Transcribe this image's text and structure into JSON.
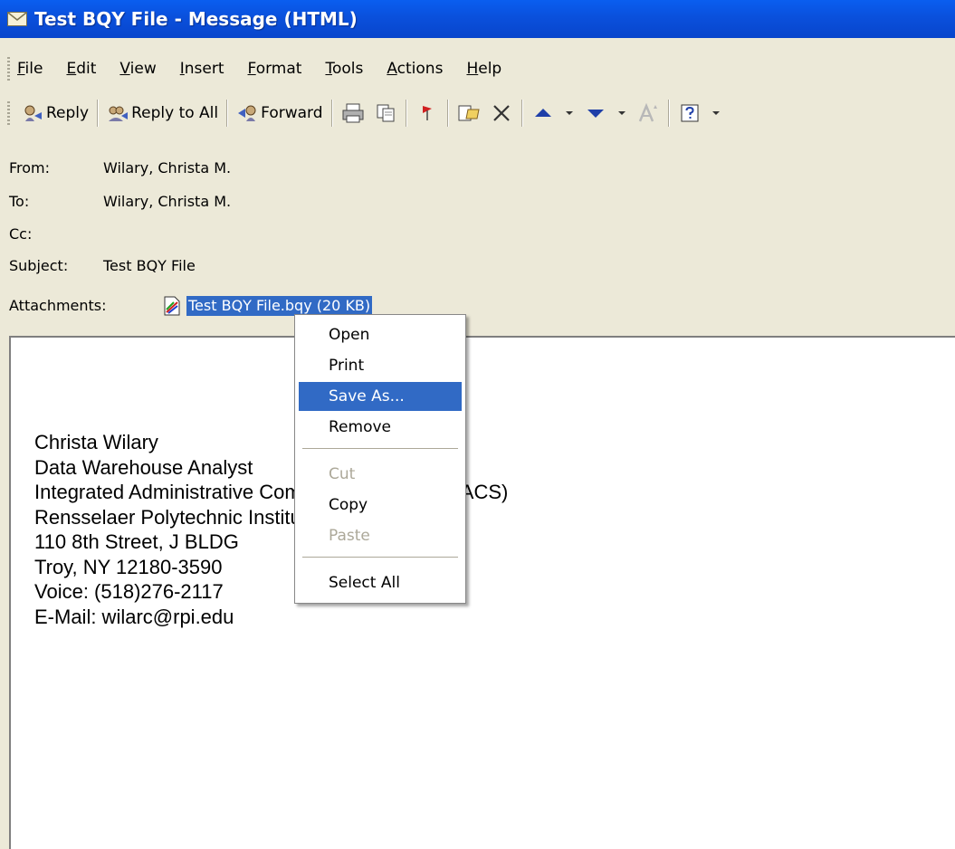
{
  "window": {
    "title": "Test BQY File - Message (HTML)"
  },
  "menu": [
    "File",
    "Edit",
    "View",
    "Insert",
    "Format",
    "Tools",
    "Actions",
    "Help"
  ],
  "toolbar": {
    "reply_label": "Reply",
    "reply_all_label": "Reply to All",
    "forward_label": "Forward"
  },
  "headers": {
    "from_label": "From:",
    "from_value": "Wilary, Christa M.",
    "to_label": "To:",
    "to_value": "Wilary, Christa M.",
    "cc_label": "Cc:",
    "cc_value": "",
    "subject_label": "Subject:",
    "subject_value": "Test BQY File",
    "attachments_label": "Attachments:",
    "attachment_name": "Test BQY File.bqy (20 KB)"
  },
  "signature": [
    "Christa Wilary",
    "Data Warehouse Analyst",
    "Integrated Administrative Computing Solutions (IACS)",
    "Rensselaer Polytechnic Institute",
    "110 8th Street, J BLDG",
    "Troy, NY 12180-3590",
    "Voice: (518)276-2117",
    "E-Mail: wilarc@rpi.edu"
  ],
  "context_menu": {
    "open": "Open",
    "print": "Print",
    "save_as": "Save As...",
    "remove": "Remove",
    "cut": "Cut",
    "copy": "Copy",
    "paste": "Paste",
    "select_all": "Select All"
  }
}
